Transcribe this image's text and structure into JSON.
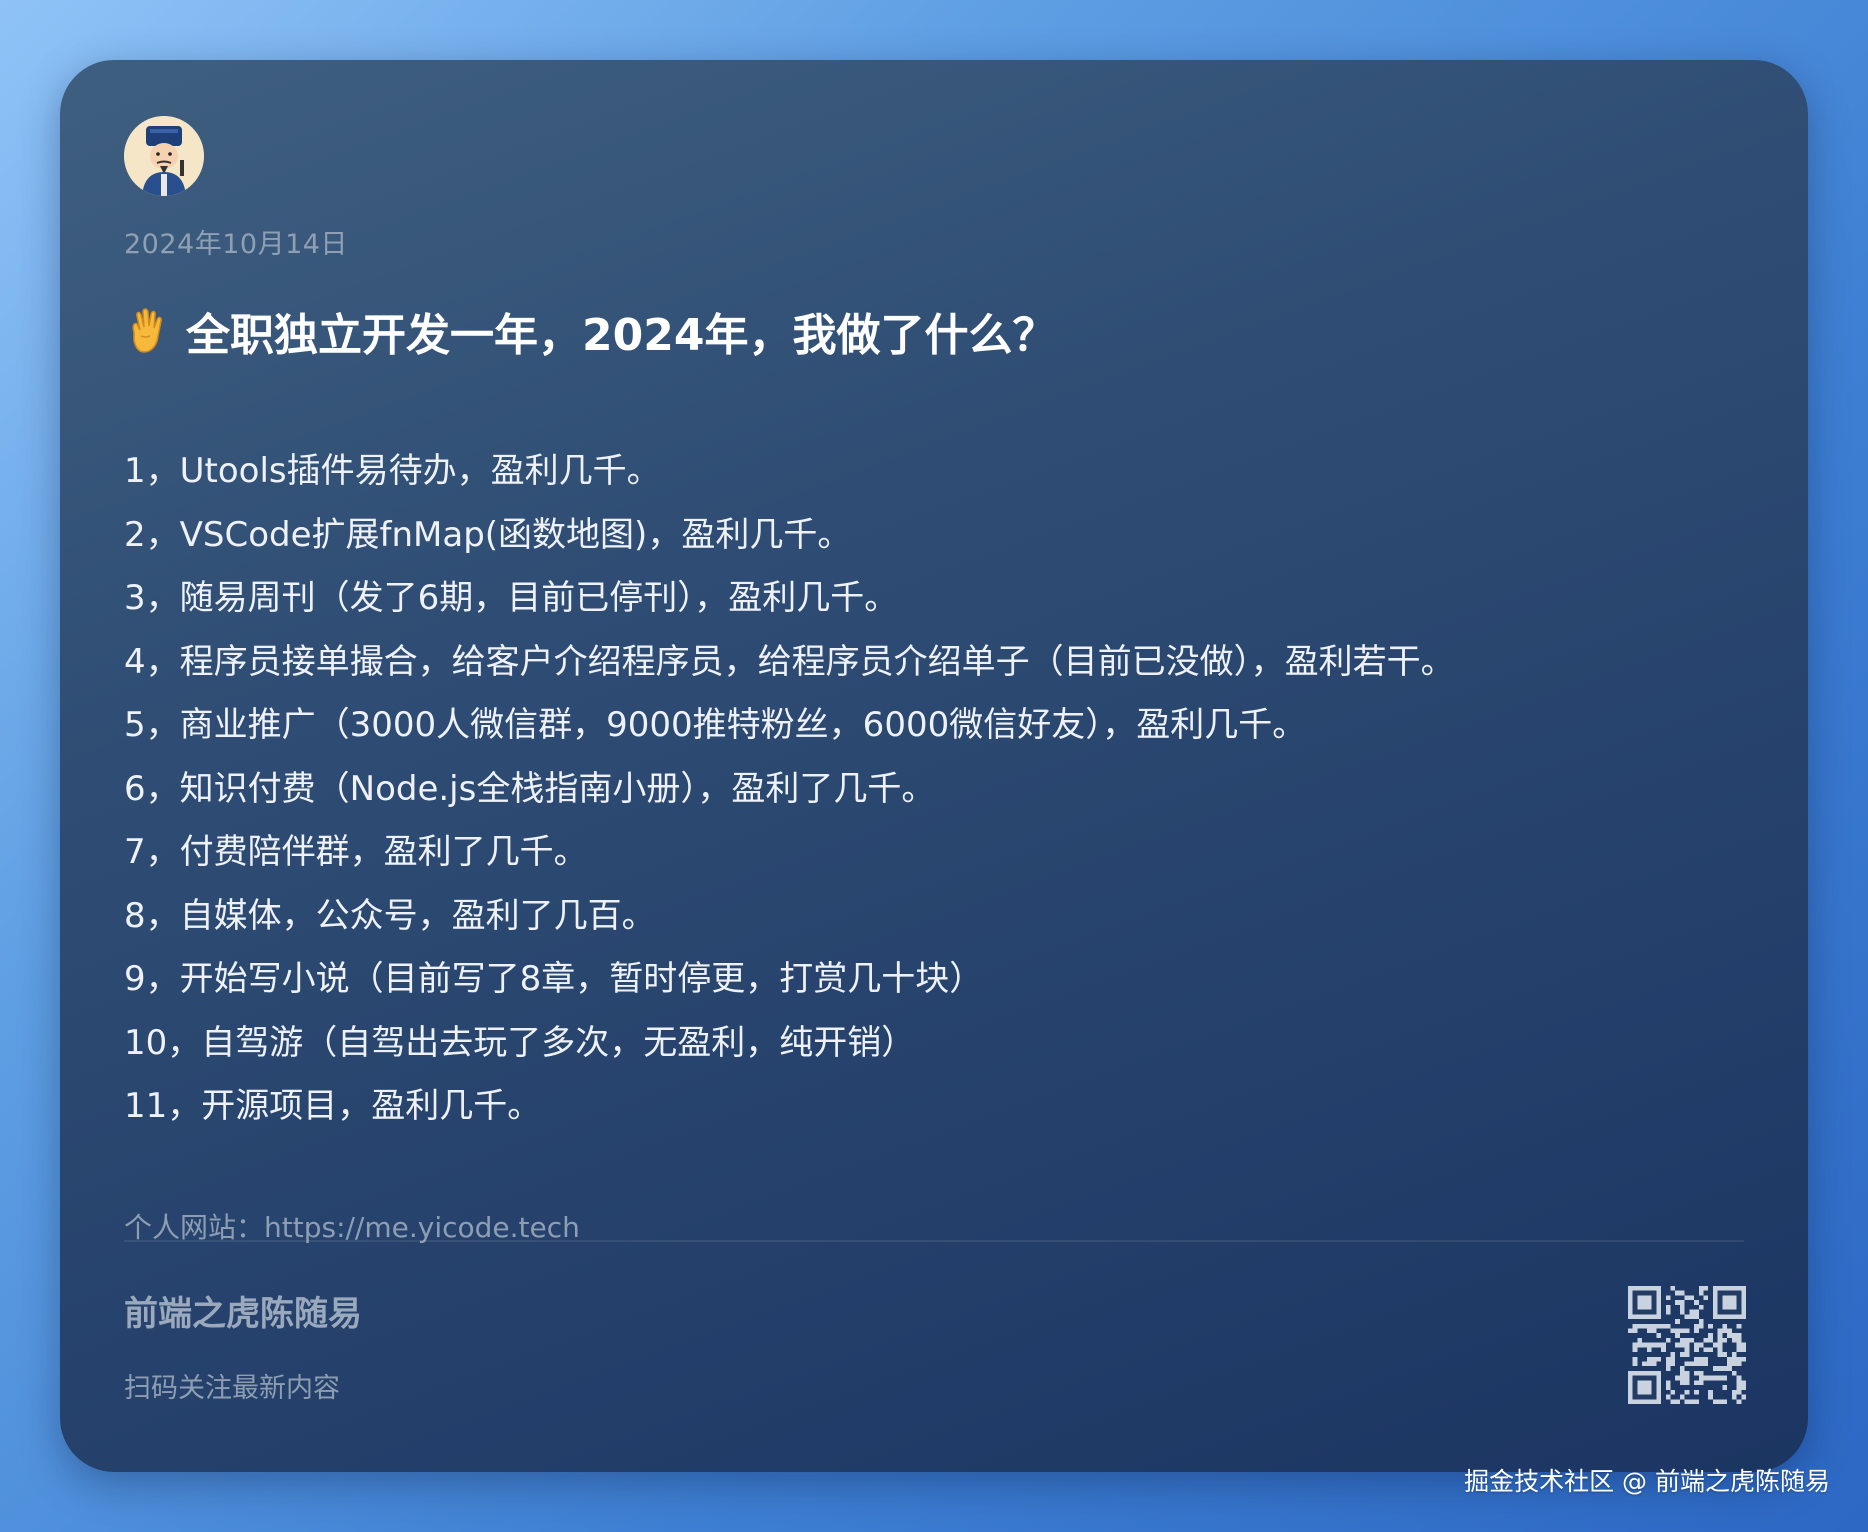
{
  "post": {
    "date": "2024年10月14日",
    "title_icon": "raised-hand-emoji",
    "title": "全职独立开发一年，2024年，我做了什么？",
    "items": [
      "1，Utools插件易待办，盈利几千。",
      "2，VSCode扩展fnMap(函数地图)，盈利几千。",
      "3，随易周刊（发了6期，目前已停刊），盈利几千。",
      "4，程序员接单撮合，给客户介绍程序员，给程序员介绍单子（目前已没做），盈利若干。",
      "5，商业推广（3000人微信群，9000推特粉丝，6000微信好友），盈利几千。",
      "6，知识付费（Node.js全栈指南小册），盈利了几千。",
      "7，付费陪伴群，盈利了几千。",
      "8，自媒体，公众号，盈利了几百。",
      "9，开始写小说（目前写了8章，暂时停更，打赏几十块）",
      "10，自驾游（自驾出去玩了多次，无盈利，纯开销）",
      "11，开源项目，盈利几千。"
    ],
    "website": "个人网站：https://me.yicode.tech"
  },
  "footer": {
    "author": "前端之虎陈随易",
    "scan_hint": "扫码关注最新内容",
    "qr_icon": "qr-code"
  },
  "watermark": "掘金技术社区 @ 前端之虎陈随易",
  "colors": {
    "card_top": "#3f5f80",
    "card_bottom": "#1c3562",
    "background": "#5e9ee3",
    "title": "#ffffff",
    "muted": "#8d9db2"
  }
}
